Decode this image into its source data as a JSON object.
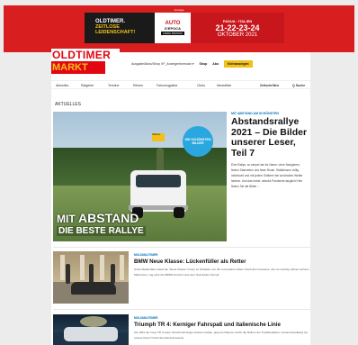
{
  "ad": {
    "label": "Anzeige",
    "left_line1": "OLDTIMER.",
    "left_line2": "ZEITLOSE",
    "left_line3": "LEIDENSCHAFT!",
    "logo_line1": "AUTO",
    "logo_line2": "D'EPOCA",
    "logo_line3": "FIERA PADOVA",
    "right_city": "PADUA · ITALIEN",
    "right_dates": "21-22-23-24",
    "right_month": "OKTOBER 2021"
  },
  "brand": {
    "logo_top": "OLDTIMER",
    "logo_bottom": "MARKT"
  },
  "top_nav": {
    "selector": "Ausgabe/Abos/Shop VF_Anzeigenformular ▾",
    "shop": "Shop",
    "abo": "Abo",
    "cta": "Kleinanzeigen"
  },
  "menu": {
    "items": [
      "Aktuelles",
      "Ratgeber",
      "Termine",
      "Reisen",
      "Fahrzeugpläne",
      "Clubs",
      "Newsletter"
    ],
    "magazines": "Zeitschriften",
    "search": "Q Suche"
  },
  "section_title": "AKTUELLES",
  "featured": {
    "kicker": "MIT ABSTAND AM SCHÖNSTEN",
    "title": "Abstandsrallye 2021 – Die Bilder unserer Leser, Teil 7",
    "desc": "Eine Rallye, so simpel wie ihr Name: ohne Navigieren, festen Startzeiten und feste Route. Stattdessen völlig individuell und mit jedem Oldtimer bei schönstem Wetter fahrbar. Und das beste: absolut Pandemie-tauglich! Hier finden Sie die Bilder ...",
    "image_badge": "DIE SCHÖNSTEN BILDER",
    "image_sign": "Oldtimer",
    "image_overlay_line1_prefix": "MIT",
    "image_overlay_line1_big": "ABSTAND",
    "image_overlay_line2": "DIE BESTE RALLYE"
  },
  "articles": [
    {
      "kicker": "MOLDMAXTIMER",
      "title": "BMW Neue Klasse: Lückenfüller als Retter",
      "desc": "Unter Markenfans stand die \"Neue Klasse\" immer im Schatten von 02 und anderen Stars. Doch die Limousine, die vor sechzig Jahren auf den Markt kam, zog einst den BMW-Konzern aus dem finanziellen Sumpf"
    },
    {
      "kicker": "MOLDMAXTIMER",
      "title": "Triumph TR 4: Kerniger Fahrspaß und italienische Linie",
      "desc": "Als 1961 der neue TR 4 seine Verschmelzungen feierten wollen, ging ein Raunen durch die Reihen der Traditionalisten. Automechanikerg tse unsere Ikone? Doch die Italo-Karosserie"
    }
  ]
}
